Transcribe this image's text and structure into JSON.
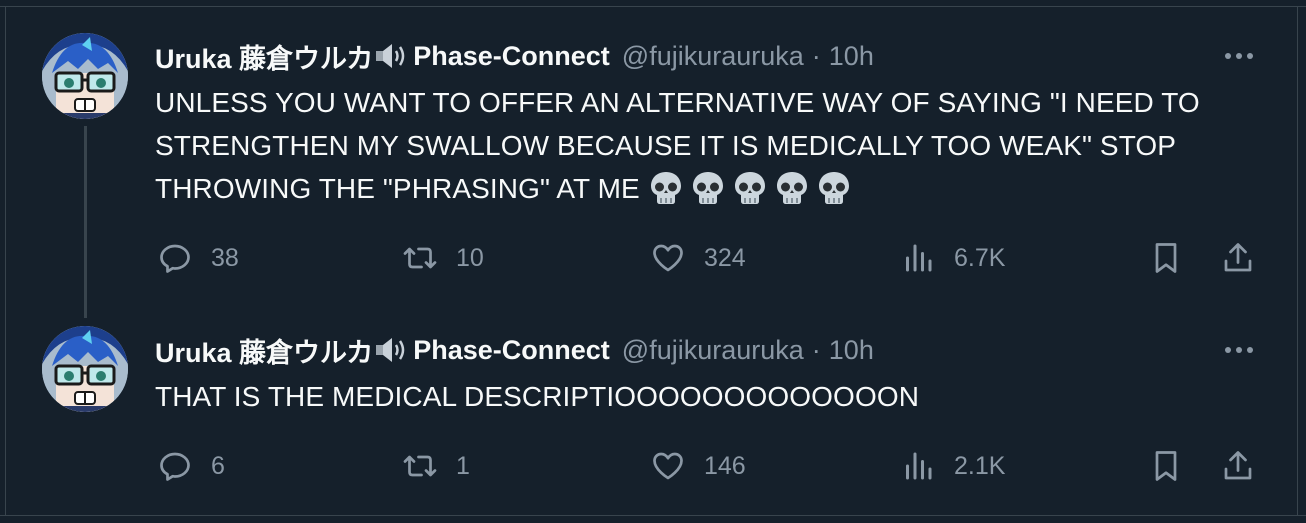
{
  "tweets": [
    {
      "display_name": "Uruka 藤倉ウルカ",
      "name_suffix": "Phase-Connect",
      "handle": "@fujikurauruka",
      "separator": "·",
      "time": "10h",
      "text": "UNLESS YOU WANT TO OFFER AN ALTERNATIVE WAY OF SAYING \"I NEED TO STRENGTHEN MY SWALLOW BECAUSE IT IS MEDICALLY TOO WEAK\" STOP THROWING THE \"PHRASING\" AT ME",
      "emoji_icons": [
        "skull-icon",
        "skull-icon",
        "skull-icon",
        "skull-icon",
        "skull-icon"
      ],
      "replies": "38",
      "retweets": "10",
      "likes": "324",
      "views": "6.7K"
    },
    {
      "display_name": "Uruka 藤倉ウルカ",
      "name_suffix": "Phase-Connect",
      "handle": "@fujikurauruka",
      "separator": "·",
      "time": "10h",
      "text": "THAT IS THE MEDICAL DESCRIPTIOOOOOOOOOOOOON",
      "replies": "6",
      "retweets": "1",
      "likes": "146",
      "views": "2.1K"
    }
  ],
  "icons": [
    "more-icon",
    "reply-icon",
    "retweet-icon",
    "like-icon",
    "views-icon",
    "bookmark-icon",
    "share-icon",
    "speaker-icon"
  ],
  "colors": {
    "background": "#15202b",
    "text": "#f7f9f9",
    "muted": "#8b98a5",
    "border": "#38444d"
  }
}
